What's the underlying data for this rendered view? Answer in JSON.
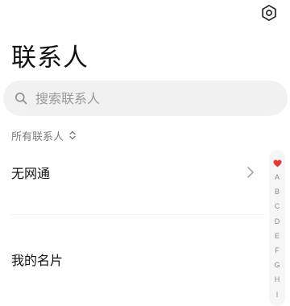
{
  "header": {
    "title": "联系人",
    "settings_icon": "settings-hexagon-icon"
  },
  "search": {
    "placeholder": "搜索联系人",
    "value": "",
    "icon": "search-icon"
  },
  "filter": {
    "label": "所有联系人",
    "icon": "sort-updown-icon"
  },
  "rows": [
    {
      "label": "无网通",
      "icon": "chevron-right-icon"
    },
    {
      "label": "我的名片"
    }
  ],
  "alpha_index": {
    "favorite_icon": "heart-icon",
    "favorite_color": "#e53935",
    "letters": [
      "A",
      "B",
      "C",
      "D",
      "E",
      "F",
      "G",
      "H",
      "I"
    ]
  }
}
